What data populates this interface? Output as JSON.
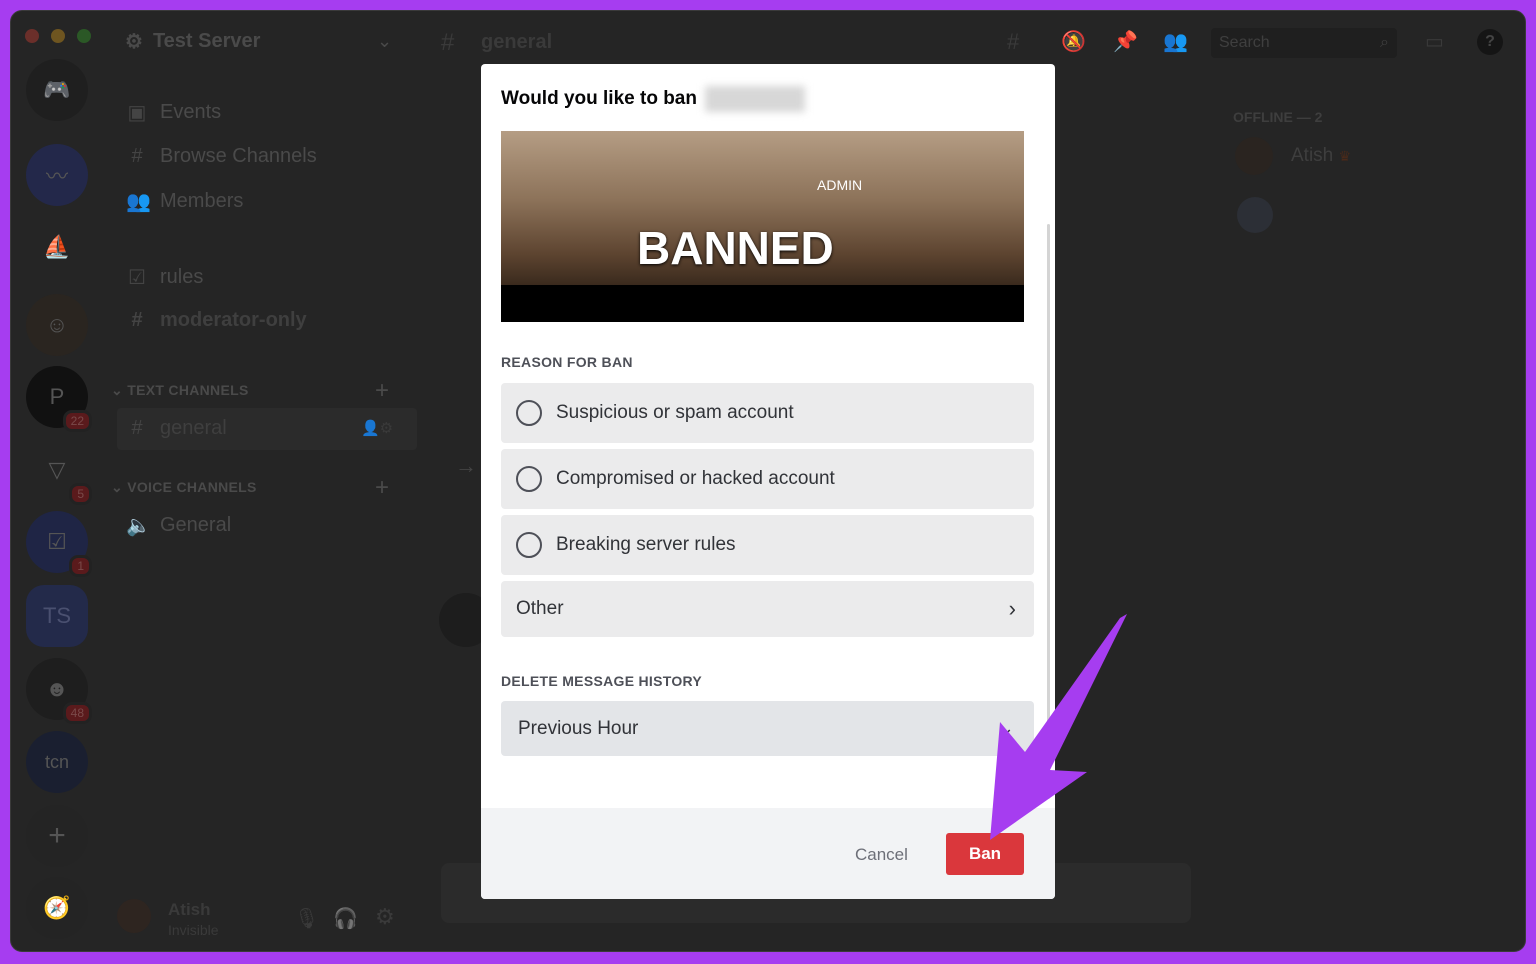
{
  "window": {
    "traffic_lights": [
      "#ed6a5e",
      "#f5bf4f",
      "#61c554"
    ]
  },
  "server": {
    "name": "Test Server"
  },
  "rail": {
    "badges": [
      "22",
      "5",
      "1",
      "48"
    ],
    "ts_label": "TS",
    "tcn_label": "tcn"
  },
  "sidebar": {
    "items": [
      {
        "label": "Events",
        "icon": "calendar-icon"
      },
      {
        "label": "Browse Channels",
        "icon": "browse-channels-icon"
      },
      {
        "label": "Members",
        "icon": "members-icon"
      },
      {
        "label": "rules",
        "icon": "rules-icon"
      },
      {
        "label": "moderator-only",
        "icon": "hash-lock-icon"
      }
    ],
    "text_category": "TEXT CHANNELS",
    "text_channels": [
      {
        "label": "general"
      }
    ],
    "voice_category": "VOICE CHANNELS",
    "voice_channels": [
      {
        "label": "General"
      }
    ]
  },
  "user": {
    "name": "Atish",
    "status": "Invisible"
  },
  "header": {
    "channel": "general",
    "search_placeholder": "Search"
  },
  "members": {
    "offline_header": "OFFLINE — 2",
    "list": [
      {
        "name": "Atish"
      }
    ]
  },
  "modal": {
    "title": "Would you like to ban",
    "image_text": {
      "top": "ADMIN",
      "main": "BANNED"
    },
    "reason_label": "REASON FOR BAN",
    "reasons": [
      "Suspicious or spam account",
      "Compromised or hacked account",
      "Breaking server rules"
    ],
    "other_label": "Other",
    "history_label": "DELETE MESSAGE HISTORY",
    "history_value": "Previous Hour",
    "cancel_label": "Cancel",
    "ban_label": "Ban",
    "ban_color": "#da373c"
  },
  "annotation": {
    "arrow_color": "#a63df0"
  }
}
